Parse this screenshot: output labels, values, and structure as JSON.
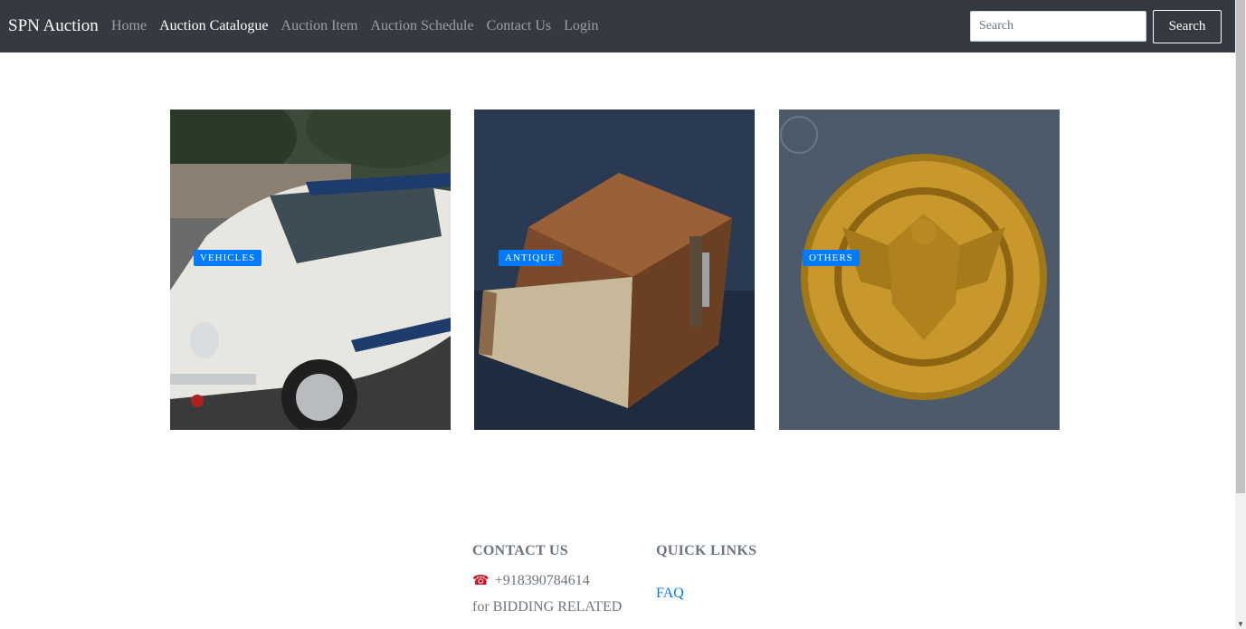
{
  "navbar": {
    "brand": "SPN Auction",
    "links": [
      {
        "label": "Home",
        "active": false
      },
      {
        "label": "Auction Catalogue",
        "active": true
      },
      {
        "label": "Auction Item",
        "active": false
      },
      {
        "label": "Auction Schedule",
        "active": false
      },
      {
        "label": "Contact Us",
        "active": false
      },
      {
        "label": "Login",
        "active": false
      }
    ],
    "search_placeholder": "Search",
    "search_button": "Search"
  },
  "categories": [
    {
      "badge": "VEHICLES",
      "image": "white vintage car"
    },
    {
      "badge": "ANTIQUE",
      "image": "old leather book"
    },
    {
      "badge": "OTHERS",
      "image": "gold coin"
    }
  ],
  "footer": {
    "contact_heading": "CONTACT US",
    "phone": "+918390784614",
    "phone_icon": "telephone-icon",
    "note": "for BIDDING RELATED",
    "quick_links_heading": "QUICK LINKS",
    "links": [
      "FAQ"
    ]
  },
  "colors": {
    "navbar_bg": "#343a40",
    "badge_bg": "#007bff",
    "link": "#007bff"
  }
}
